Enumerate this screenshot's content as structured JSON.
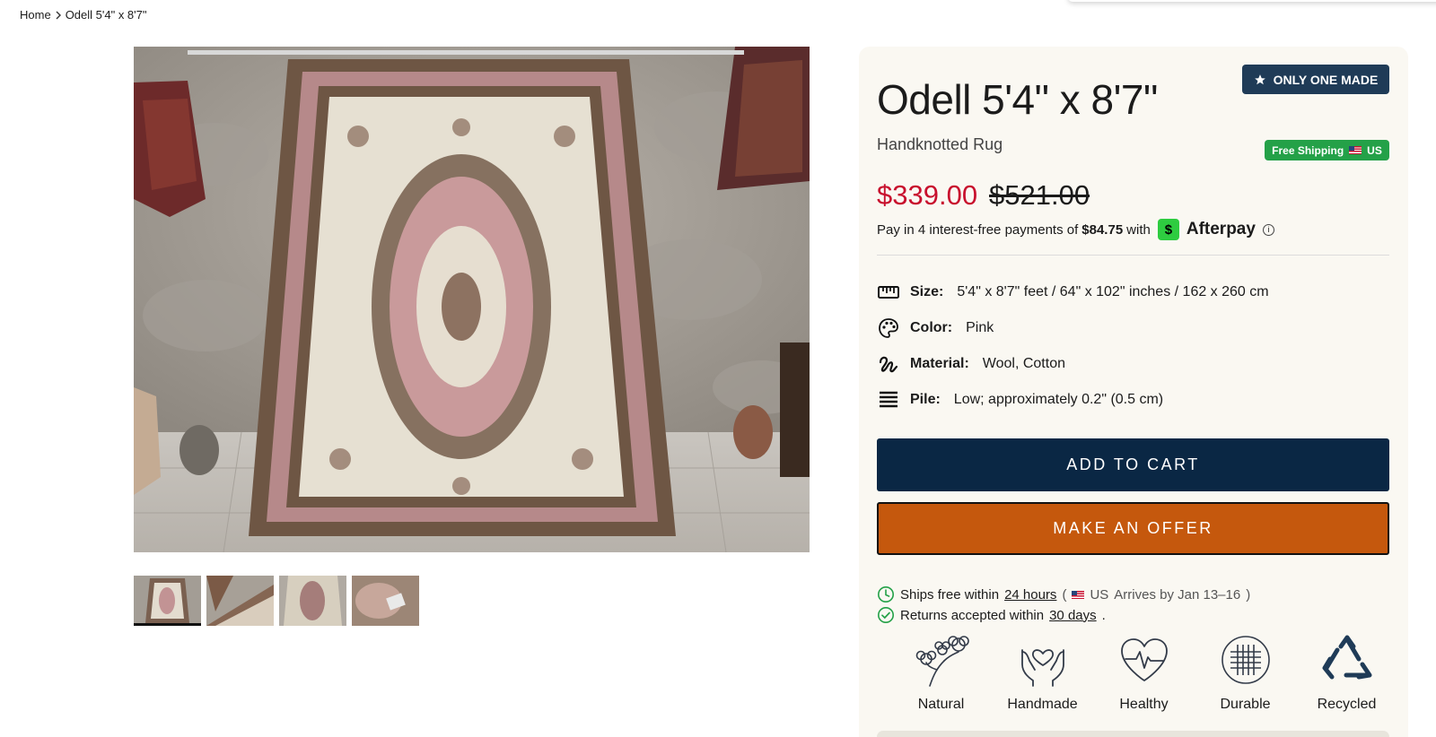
{
  "breadcrumb": {
    "home": "Home",
    "current": "Odell 5'4\" x 8'7\""
  },
  "product": {
    "title": "Odell 5'4\" x 8'7\"",
    "subtitle": "Handknotted Rug",
    "badge_unique": "ONLY ONE MADE",
    "badge_shipping": "Free Shipping",
    "badge_shipping_region": "US",
    "price_sale": "$339.00",
    "price_original": "$521.00"
  },
  "afterpay": {
    "prefix": "Pay in 4 interest-free payments of",
    "amount": "$84.75",
    "with": "with",
    "logo_glyph": "$",
    "brand": "Afterpay",
    "info": "i"
  },
  "specs": [
    {
      "key": "Size:",
      "value": "5'4\" x 8'7\" feet / 64\" x 102\" inches / 162 x 260 cm",
      "icon": "ruler-icon"
    },
    {
      "key": "Color:",
      "value": "Pink",
      "icon": "palette-icon"
    },
    {
      "key": "Material:",
      "value": "Wool, Cotton",
      "icon": "yarn-icon"
    },
    {
      "key": "Pile:",
      "value": "Low; approximately 0.2\" (0.5 cm)",
      "icon": "layers-icon"
    }
  ],
  "actions": {
    "add_to_cart": "ADD TO CART",
    "make_offer": "MAKE AN OFFER"
  },
  "shipping": {
    "ships_prefix": "Ships free within",
    "ships_link": "24 hours",
    "open_paren": "(",
    "region": "US",
    "arrives": "Arrives by Jan 13–16",
    "close_paren": ")",
    "returns_prefix": "Returns accepted within",
    "returns_link": "30 days",
    "returns_suffix": "."
  },
  "features": [
    {
      "label": "Natural",
      "icon": "cotton-flower-icon"
    },
    {
      "label": "Handmade",
      "icon": "hands-heart-icon"
    },
    {
      "label": "Healthy",
      "icon": "heartbeat-icon"
    },
    {
      "label": "Durable",
      "icon": "weave-icon"
    },
    {
      "label": "Recycled",
      "icon": "recycle-icon"
    }
  ],
  "gallery": {
    "thumbnail_count": 4,
    "active_thumbnail": 1
  },
  "colors": {
    "navy": "#0a2744",
    "offer_orange": "#c5580d",
    "sale_red": "#c8102e",
    "badge_blue": "#1f3b57",
    "shipping_green": "#24a148",
    "panel_bg": "#faf8f2"
  }
}
